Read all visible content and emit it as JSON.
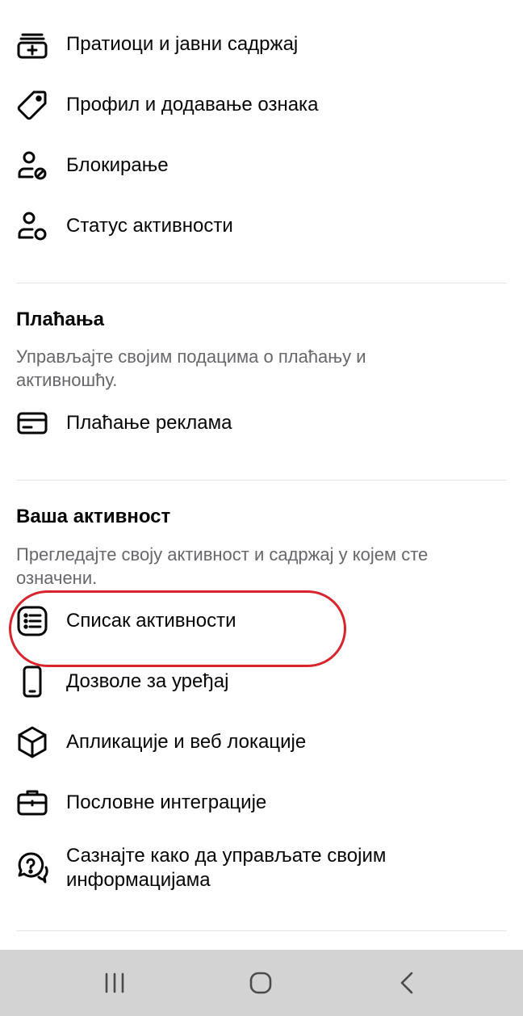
{
  "top_items": [
    {
      "label": "Пратиоци и јавни садржај",
      "icon": "followers-add-icon"
    },
    {
      "label": "Профил и додавање ознака",
      "icon": "tag-icon"
    },
    {
      "label": "Блокирање",
      "icon": "user-block-icon"
    },
    {
      "label": "Статус активности",
      "icon": "user-status-icon"
    }
  ],
  "payments": {
    "title": "Плаћања",
    "description": "Управљајте својим подацима о плаћању и активношћу.",
    "items": [
      {
        "label": "Плаћање реклама",
        "icon": "credit-card-icon"
      }
    ]
  },
  "activity": {
    "title": "Ваша активност",
    "description": "Прегледајте своју активност и садржај у којем сте означени.",
    "items": [
      {
        "label": "Списак активности",
        "icon": "list-icon",
        "highlighted": true
      },
      {
        "label": "Дозволе за уређај",
        "icon": "phone-icon"
      },
      {
        "label": "Апликације и веб локације",
        "icon": "cube-icon"
      },
      {
        "label": "Пословне интеграције",
        "icon": "briefcase-icon"
      },
      {
        "label": "Сазнајте како да управљате својим информацијама",
        "icon": "help-chat-icon"
      }
    ]
  },
  "system_nav": {
    "buttons": [
      {
        "name": "recent-apps-icon"
      },
      {
        "name": "home-icon"
      },
      {
        "name": "back-icon"
      }
    ]
  },
  "colors": {
    "text": "#050505",
    "secondary_text": "#65676b",
    "divider": "#e4e6eb",
    "highlight": "#d8242c",
    "navbar": "#d3d3d3"
  }
}
